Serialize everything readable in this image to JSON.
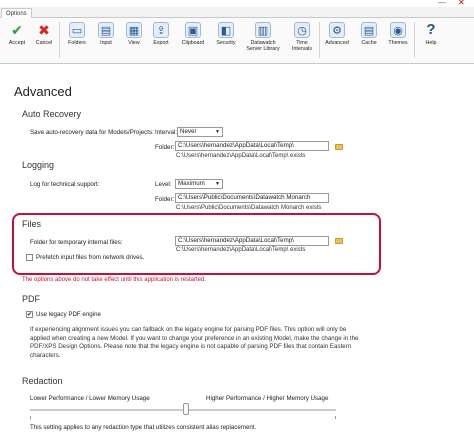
{
  "window": {
    "minimize_glyph": "—",
    "close_glyph": "✕"
  },
  "tab": {
    "label": "Options"
  },
  "ribbon": {
    "buttons": [
      {
        "label": "Accept",
        "icon": "checkmark-icon",
        "glyph": "✔"
      },
      {
        "label": "Cancel",
        "icon": "cancel-x-icon",
        "glyph": "✖"
      },
      {
        "label": "Folders",
        "icon": "folders-icon",
        "glyph": "▭"
      },
      {
        "label": "Input",
        "icon": "input-icon",
        "glyph": "▤"
      },
      {
        "label": "View",
        "icon": "view-icon",
        "glyph": "▦"
      },
      {
        "label": "Export",
        "icon": "export-icon",
        "glyph": "⇪"
      },
      {
        "label": "Clipboard",
        "icon": "clipboard-icon",
        "glyph": "▣"
      },
      {
        "label": "Security",
        "icon": "security-icon",
        "glyph": "◧"
      },
      {
        "label": "Datawatch",
        "label2": "Server Library",
        "icon": "server-library-icon",
        "glyph": "▥"
      },
      {
        "label": "Time",
        "label2": "Intervals",
        "icon": "clock-icon",
        "glyph": "◷"
      },
      {
        "label": "Advanced",
        "icon": "advanced-wrench-icon",
        "glyph": "⚙"
      },
      {
        "label": "Cache",
        "icon": "cache-database-icon",
        "glyph": "▤"
      },
      {
        "label": "Themes",
        "icon": "themes-palette-icon",
        "glyph": "◉"
      },
      {
        "label": "Help",
        "icon": "help-icon",
        "glyph": "?"
      }
    ]
  },
  "page": {
    "title": "Advanced"
  },
  "auto_recovery": {
    "heading": "Auto Recovery",
    "save_label": "Save auto-recovery data for Models/Projects:",
    "interval_label": "Interval:",
    "interval_value": "Never",
    "folder_label": "Folder:",
    "folder_value": "C:\\Users\\hernandez\\AppData\\Local\\Temp\\",
    "folder_status": "C:\\Users\\hernandez\\AppData\\Local\\Temp\\ exists"
  },
  "logging": {
    "heading": "Logging",
    "log_label": "Log for technical support:",
    "level_label": "Level:",
    "level_value": "Maximum",
    "folder_label": "Folder:",
    "folder_value": "C:\\Users\\Public\\Documents\\Datawatch Monarch",
    "folder_status": "C:\\Users\\Public\\Documents\\Datawatch Monarch exists"
  },
  "files": {
    "heading": "Files",
    "temp_label": "Folder for temporary internal files:",
    "temp_value": "C:\\Users\\hernandez\\AppData\\Local\\Temp\\",
    "temp_status": "C:\\Users\\hernandez\\AppData\\Local\\Temp\\ exists",
    "prefetch_label": "Prefetch input files from network drives.",
    "prefetch_checked": false
  },
  "warning": "The options above do not take effect until this application is restarted.",
  "pdf": {
    "heading": "PDF",
    "legacy_label": "Use legacy PDF engine",
    "legacy_checked": true,
    "description": "If experiencing alignment issues you can fallback on the legacy engine for parsing PDF files. This option will only be applied when creating a new Model. If you want to change your preference in an existing Model, make the change in the PDF/XPS Design Options. Please note that the legacy engine is not capable of parsing PDF files that contain Eastern characters."
  },
  "redaction": {
    "heading": "Redaction",
    "low_label": "Lower Performance / Lower Memory Usage",
    "high_label": "Higher Performance / Higher Memory Usage",
    "slider_fraction": 0.5,
    "note": "This setting applies to any redaction type that utilizes consistent alias replacement."
  }
}
